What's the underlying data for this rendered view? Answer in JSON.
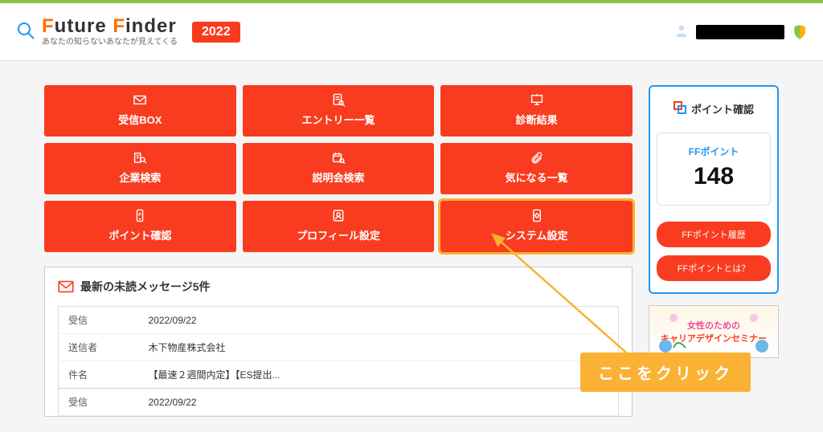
{
  "header": {
    "logo_main_f1": "F",
    "logo_main_rest1": "uture ",
    "logo_main_f2": "F",
    "logo_main_rest2": "inder",
    "logo_sub": "あなたの知らないあなたが見えてくる",
    "year": "2022"
  },
  "tiles": [
    {
      "label": "受信BOX"
    },
    {
      "label": "エントリー一覧"
    },
    {
      "label": "診断結果"
    },
    {
      "label": "企業検索"
    },
    {
      "label": "説明会検索"
    },
    {
      "label": "気になる一覧"
    },
    {
      "label": "ポイント確認"
    },
    {
      "label": "プロフィール設定"
    },
    {
      "label": "システム設定"
    }
  ],
  "messages": {
    "title": "最新の未読メッセージ5件",
    "rows": [
      {
        "label": "受信",
        "value": "2022/09/22"
      },
      {
        "label": "送信者",
        "value": "木下物産株式会社"
      },
      {
        "label": "件名",
        "value": "【最速２週間内定】【ES提出..."
      },
      {
        "label": "受信",
        "value": "2022/09/22"
      }
    ]
  },
  "points": {
    "title": "ポイント確認",
    "label": "FFポイント",
    "value": "148",
    "history_btn": "FFポイント履歴",
    "about_btn": "FFポイントとは？"
  },
  "banner": {
    "line1": "女性のための",
    "line2": "キャリアデザインセミナー"
  },
  "callout": "ここをクリック"
}
